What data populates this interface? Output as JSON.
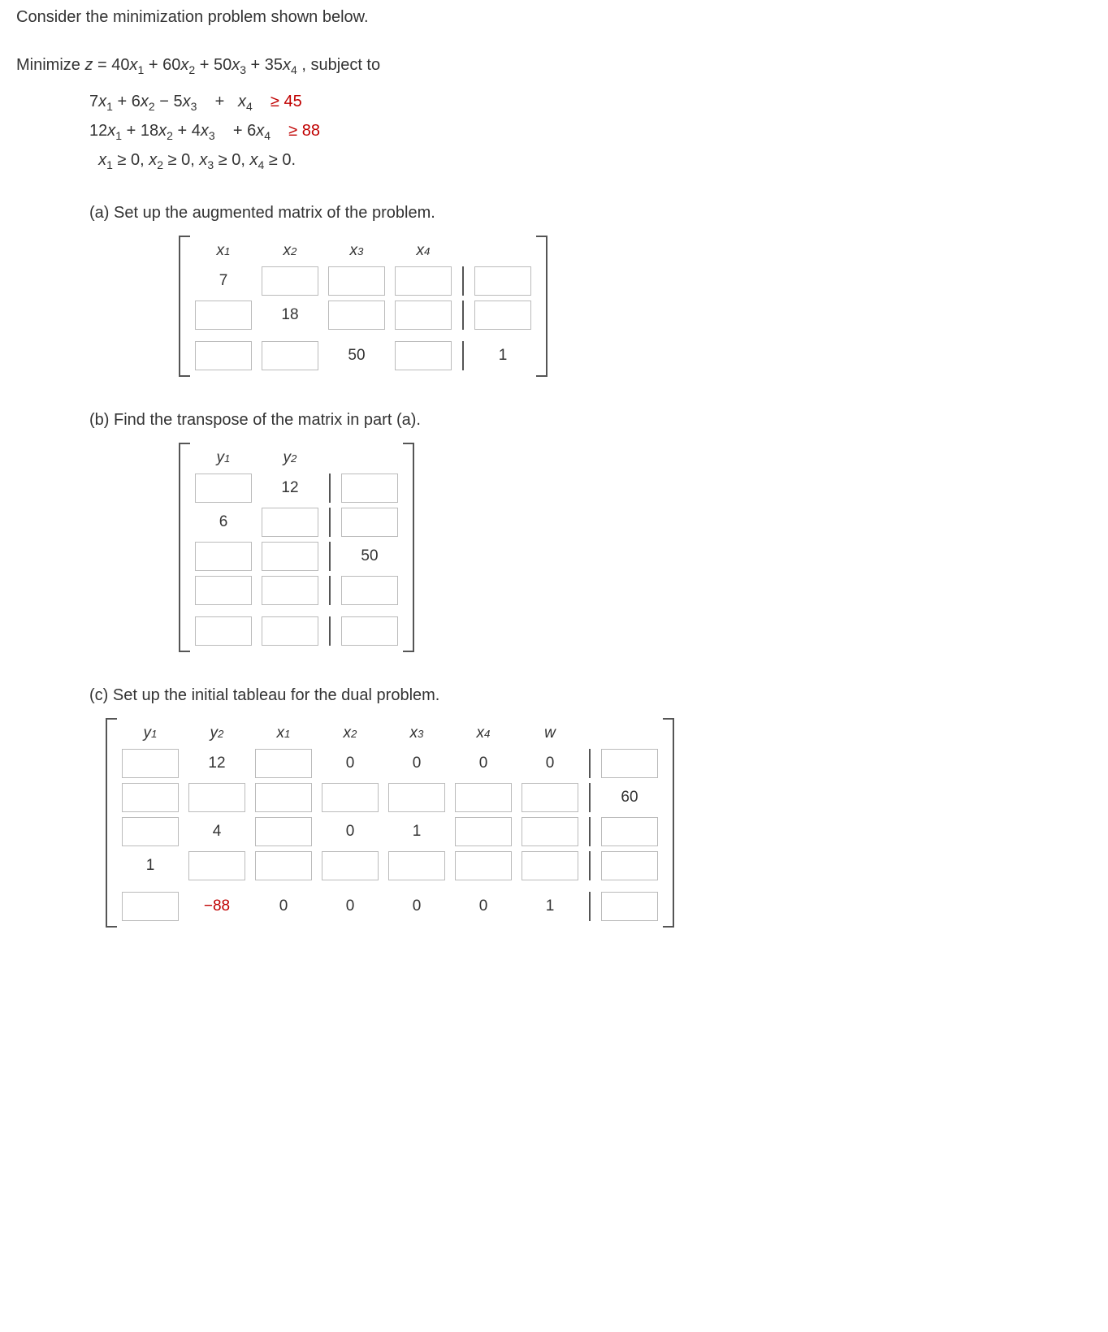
{
  "intro": "Consider the minimization problem shown below.",
  "objective_prefix": "Minimize ",
  "objective_var": "z",
  "objective_eq": " = 40",
  "objective_rest": " + 60",
  "objective_rest2": " + 50",
  "objective_rest3": " + 35",
  "objective_suffix": ", subject to",
  "x1": "x",
  "s1": "1",
  "x2": "x",
  "s2": "2",
  "x3": "x",
  "s3": "3",
  "x4": "x",
  "s4": "4",
  "y1": "y",
  "ys1": "1",
  "y2": "y",
  "ys2": "2",
  "w": "w",
  "c1_a": "7",
  "c1_b": " + 6",
  "c1_c": " − 5",
  "c1_d": " + ",
  "c1_e": " ≥ 45",
  "c2_a": "12",
  "c2_b": " + 18",
  "c2_c": " + 4",
  "c2_d": " + 6",
  "c2_e": " ≥ 88",
  "nonneg": " ≥ 0, ",
  "nonneg_end": " ≥ 0.",
  "part_a": "(a) Set up the augmented matrix of the problem.",
  "part_b": "(b) Find the transpose of the matrix in part (a).",
  "part_c": "(c) Set up the initial tableau for the dual problem.",
  "a": {
    "r1c1": "7",
    "r2c2": "18",
    "r3c3": "50",
    "r3c6": "1"
  },
  "b": {
    "r1c2": "12",
    "r2c1": "6",
    "r3c3": "50"
  },
  "c": {
    "r1c2": "12",
    "r1c4": "0",
    "r1c5": "0",
    "r1c6": "0",
    "r1c7": "0",
    "r2c8": "60",
    "r3c2": "4",
    "r3c4": "0",
    "r3c5": "1",
    "r4c1": "1",
    "r5c2": "−88",
    "r5c3": "0",
    "r5c4": "0",
    "r5c5": "0",
    "r5c6": "0",
    "r5c7": "1"
  }
}
